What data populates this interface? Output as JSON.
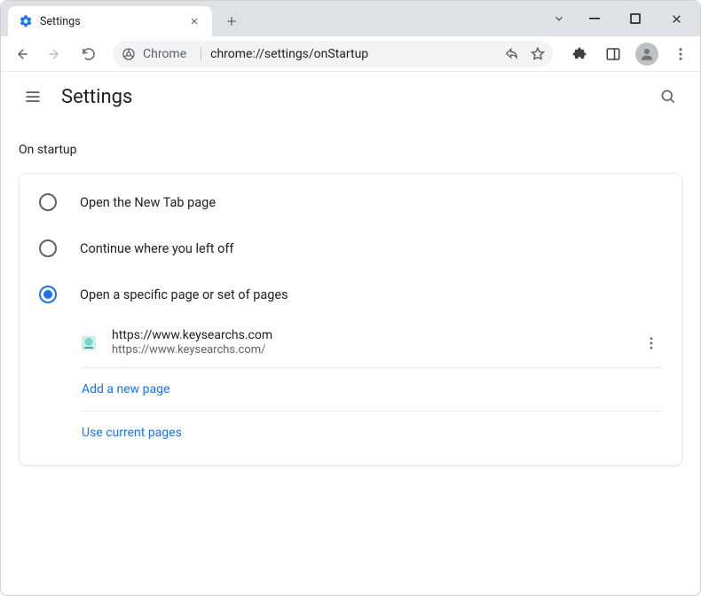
{
  "window": {
    "tab_title": "Settings",
    "omnibox_chip": "Chrome",
    "omnibox_url": "chrome://settings/onStartup"
  },
  "header": {
    "title": "Settings"
  },
  "section": {
    "title": "On startup",
    "options": [
      {
        "label": "Open the New Tab page",
        "selected": false
      },
      {
        "label": "Continue where you left off",
        "selected": false
      },
      {
        "label": "Open a specific page or set of pages",
        "selected": true
      }
    ],
    "startup_page": {
      "title": "https://www.keysearchs.com",
      "url": "https://www.keysearchs.com/"
    },
    "add_page_label": "Add a new page",
    "use_current_label": "Use current pages"
  },
  "colors": {
    "accent": "#1a73e8"
  }
}
